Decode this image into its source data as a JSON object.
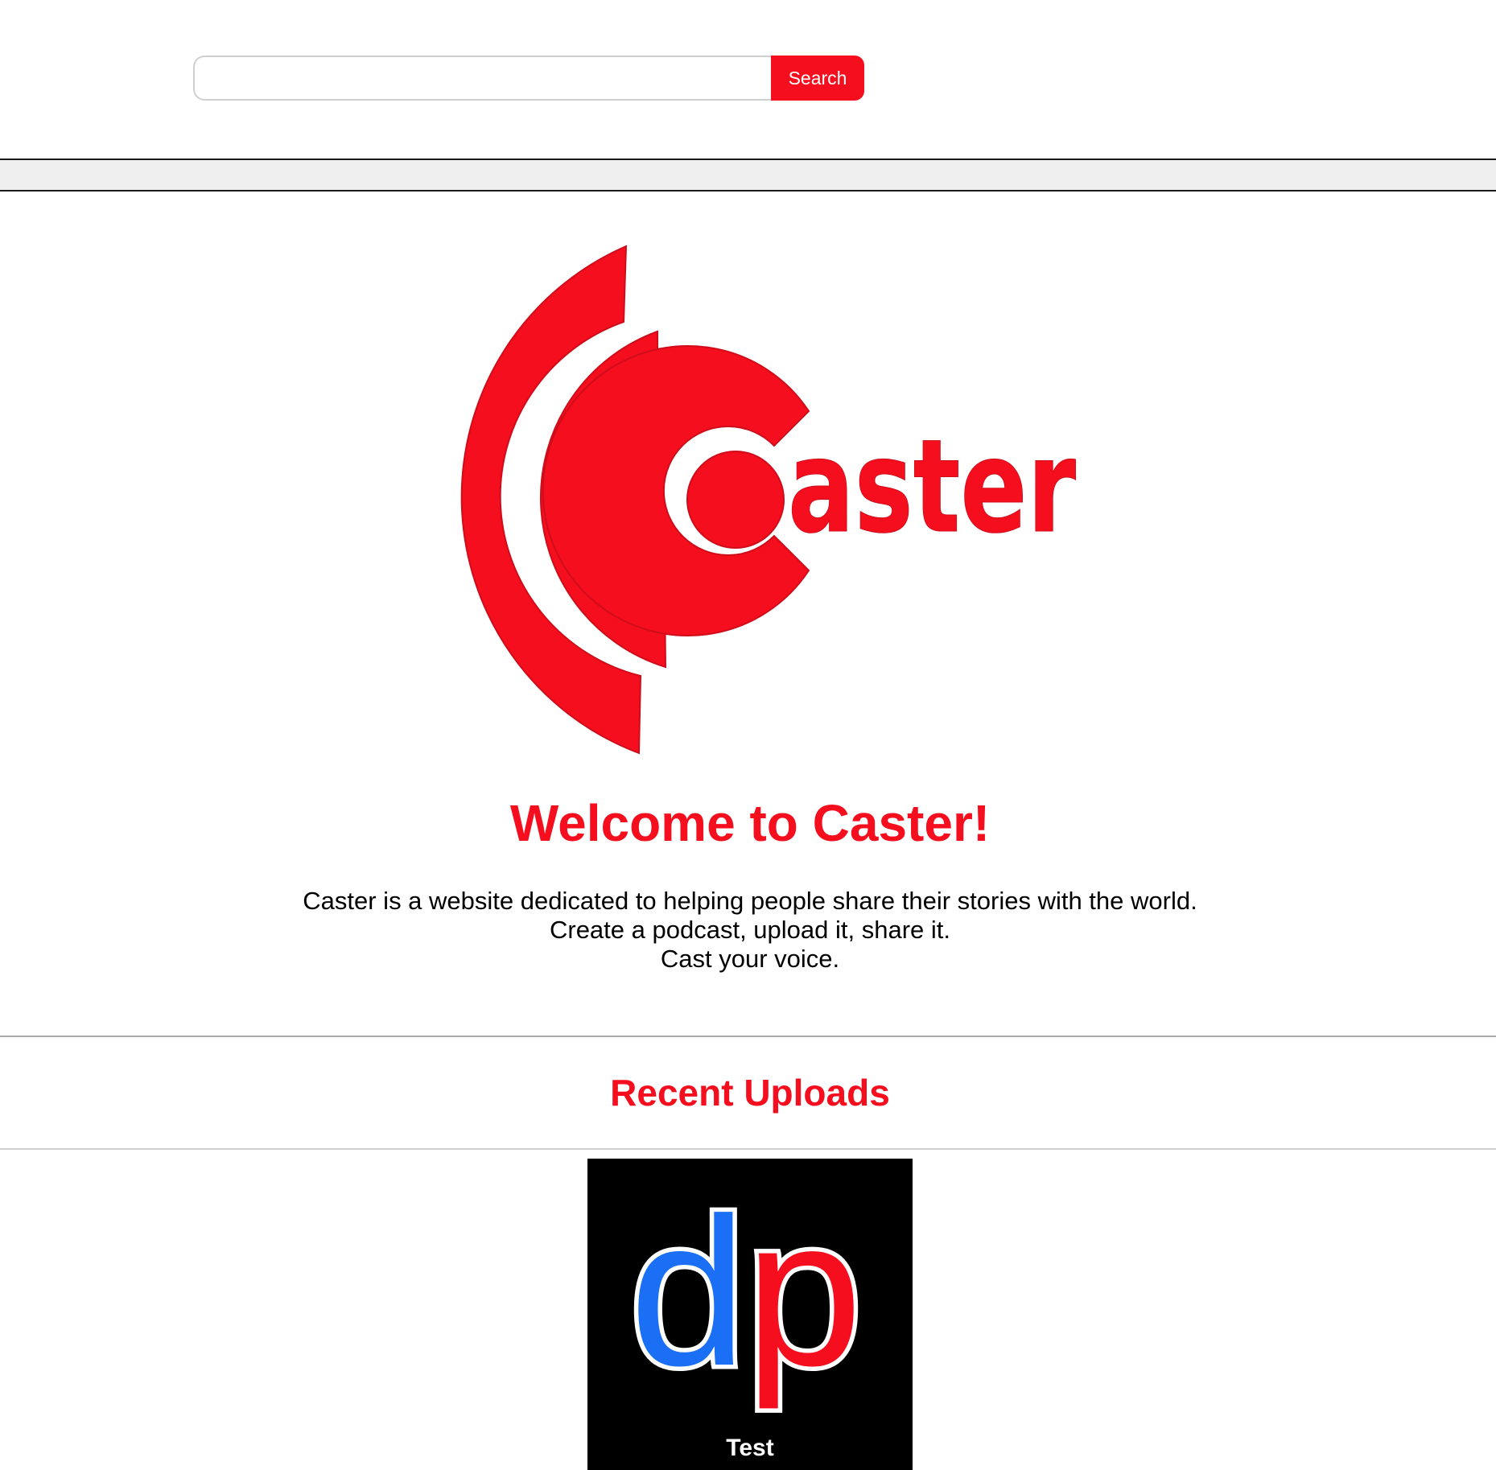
{
  "search": {
    "placeholder": "",
    "value": "",
    "button_label": "Search"
  },
  "logo": {
    "wordmark": "aster",
    "color": "#f40e1e",
    "alt": "Caster"
  },
  "welcome": {
    "title": "Welcome to Caster!",
    "lines": [
      "Caster is a website dedicated to helping people share their stories with the world.",
      "Create a podcast, upload it, share it.",
      "Cast your voice."
    ]
  },
  "recent": {
    "title": "Recent Uploads",
    "items": [
      {
        "title": "Test",
        "thumbnail": {
          "letter_1": "d",
          "letter_2": "p",
          "color_1": "#1a6ff5",
          "color_2": "#f40e1e",
          "background": "#000000"
        }
      }
    ]
  },
  "colors": {
    "accent": "#f40e1e",
    "nav_bar": "#efefef"
  }
}
